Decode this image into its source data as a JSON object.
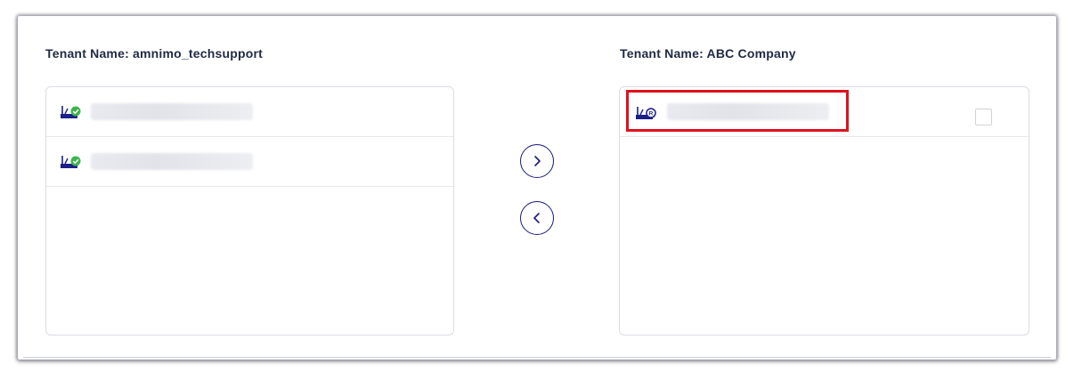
{
  "left_panel": {
    "title": "Tenant Name: amnimo_techsupport",
    "items": [
      {
        "icon": "router-online-icon",
        "name": ""
      },
      {
        "icon": "router-online-icon",
        "name": ""
      }
    ]
  },
  "right_panel": {
    "title": "Tenant Name: ABC Company",
    "items": [
      {
        "icon": "router-registered-icon",
        "name": "",
        "checked": false
      }
    ]
  },
  "controls": {
    "move_right_icon": "chevron-right-icon",
    "move_left_icon": "chevron-left-icon"
  },
  "colors": {
    "accent": "#1a1a7a",
    "title": "#1f2a44",
    "status_ok": "#3cb44b",
    "highlight": "#e0101c"
  }
}
